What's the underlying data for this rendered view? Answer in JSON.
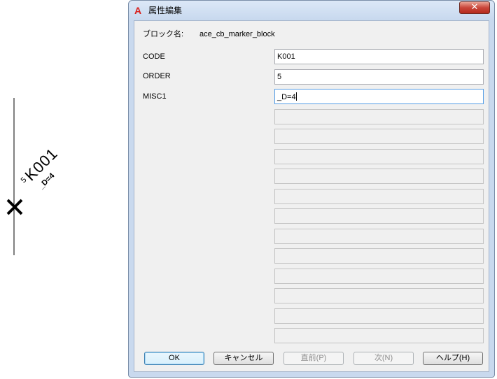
{
  "canvas": {
    "marker_label": "K001",
    "order_text": "5",
    "misc_text": "_D=4"
  },
  "dialog": {
    "title": "属性編集",
    "close_symbol": "✕",
    "block_name_label": "ブロック名:",
    "block_name_value": "ace_cb_marker_block",
    "attributes": [
      {
        "tag": "CODE",
        "value": "K001"
      },
      {
        "tag": "ORDER",
        "value": "5"
      },
      {
        "tag": "MISC1",
        "value": "_D=4"
      }
    ],
    "empty_field_count": 12,
    "buttons": {
      "ok": "OK",
      "cancel": "キャンセル",
      "prev": "直前(P)",
      "next": "次(N)",
      "help": "ヘルプ(H)"
    }
  },
  "colors": {
    "frame": "#c9d9ee",
    "close": "#c9463a",
    "app_icon": "#d8201c"
  }
}
